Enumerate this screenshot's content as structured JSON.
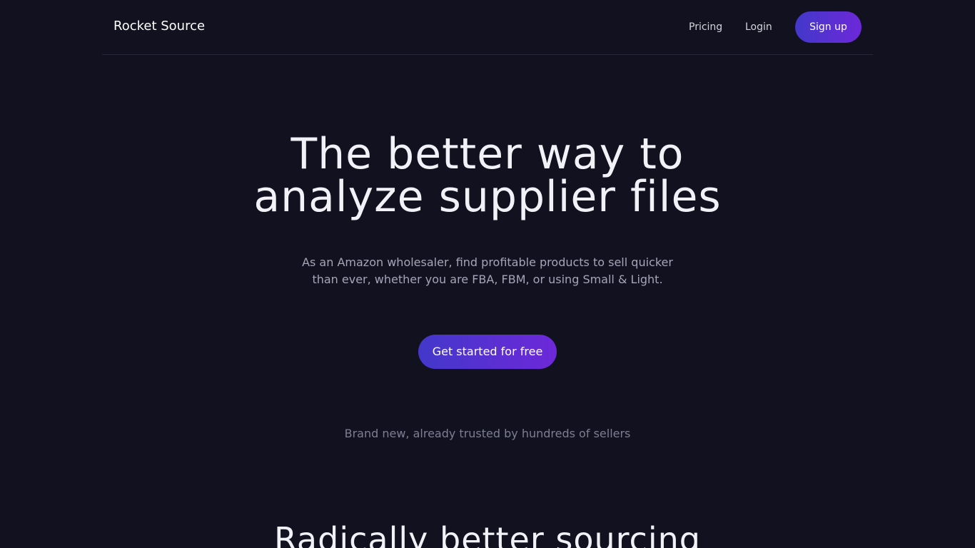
{
  "header": {
    "brand": "Rocket Source",
    "nav": {
      "pricing": "Pricing",
      "login": "Login",
      "signup": "Sign up"
    }
  },
  "hero": {
    "title_line1": "The better way to",
    "title_line2": "analyze supplier files",
    "subtitle": "As an Amazon wholesaler, find profitable products to sell quicker than ever, whether you are FBA, FBM, or using Small & Light.",
    "cta": "Get started for free",
    "trust_line": "Brand new, already trusted by hundreds of sellers"
  },
  "features": {
    "title": "Radically better sourcing"
  },
  "colors": {
    "background": "#11111f",
    "accent_start": "#4338ca",
    "accent_end": "#6d28d9",
    "text_primary": "#ffffff",
    "text_muted": "#a5a5b8"
  }
}
